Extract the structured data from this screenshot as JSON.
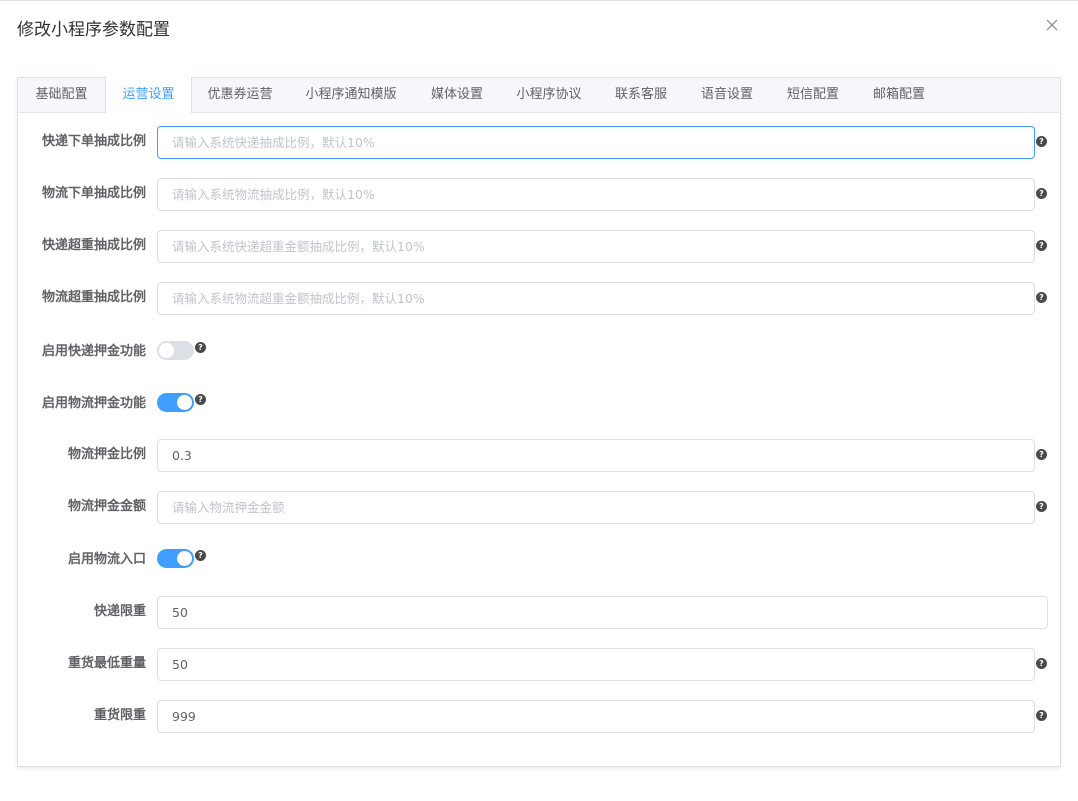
{
  "dialog": {
    "title": "修改小程序参数配置",
    "close_icon": "close-icon"
  },
  "tabs": [
    {
      "label": "基础配置",
      "active": false
    },
    {
      "label": "运营设置",
      "active": true
    },
    {
      "label": "优惠券运营",
      "active": false
    },
    {
      "label": "小程序通知模版",
      "active": false
    },
    {
      "label": "媒体设置",
      "active": false
    },
    {
      "label": "小程序协议",
      "active": false
    },
    {
      "label": "联系客服",
      "active": false
    },
    {
      "label": "语音设置",
      "active": false
    },
    {
      "label": "短信配置",
      "active": false
    },
    {
      "label": "邮箱配置",
      "active": false
    }
  ],
  "form": {
    "express_order_ratio": {
      "label": "快递下单抽成比例",
      "value": "",
      "placeholder": "请输入系统快递抽成比例，默认10%"
    },
    "logistics_order_ratio": {
      "label": "物流下单抽成比例",
      "value": "",
      "placeholder": "请输入系统物流抽成比例，默认10%"
    },
    "express_overweight_ratio": {
      "label": "快递超重抽成比例",
      "value": "",
      "placeholder": "请输入系统快递超重金额抽成比例，默认10%"
    },
    "logistics_overweight_ratio": {
      "label": "物流超重抽成比例",
      "value": "",
      "placeholder": "请输入系统物流超重金额抽成比例，默认10%"
    },
    "express_deposit_enabled": {
      "label": "启用快递押金功能",
      "on": false
    },
    "logistics_deposit_enabled": {
      "label": "启用物流押金功能",
      "on": true
    },
    "logistics_deposit_ratio": {
      "label": "物流押金比例",
      "value": "0.3",
      "placeholder": ""
    },
    "logistics_deposit_amount": {
      "label": "物流押金金额",
      "value": "",
      "placeholder": "请输入物流押金金额"
    },
    "logistics_entry_enabled": {
      "label": "启用物流入口",
      "on": true
    },
    "express_weight_limit": {
      "label": "快递限重",
      "value": "50",
      "placeholder": ""
    },
    "heavy_min_weight": {
      "label": "重货最低重量",
      "value": "50",
      "placeholder": ""
    },
    "heavy_weight_limit": {
      "label": "重货限重",
      "value": "999",
      "placeholder": ""
    }
  },
  "help_icon": {
    "glyph": "?"
  },
  "colors": {
    "accent": "#409eff",
    "switch_off": "#dcdfe6"
  }
}
